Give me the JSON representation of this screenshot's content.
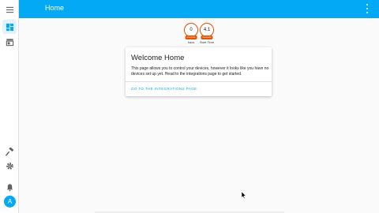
{
  "header": {
    "title": "Home"
  },
  "sidebar": {
    "avatar_initial": "A",
    "items": [
      {
        "name": "menu",
        "icon": "hamburger-icon"
      },
      {
        "name": "overview",
        "icon": "dashboard-icon",
        "active": true
      },
      {
        "name": "map",
        "icon": "store-icon"
      },
      {
        "name": "developer-tools",
        "icon": "hammer-icon"
      },
      {
        "name": "configuration",
        "icon": "gear-icon"
      },
      {
        "name": "notifications",
        "icon": "bell-icon"
      }
    ]
  },
  "badges": [
    {
      "value": "0",
      "tag": "ms (ms)",
      "label": "hacs"
    },
    {
      "value": "4.1",
      "tag": "seconds",
      "label": "Start Time"
    }
  ],
  "card": {
    "title": "Welcome Home",
    "body": "This page allows you to control your devices, however it looks like you have no devices set up yet. Head to the integrations page to get started.",
    "action": "GO TO THE INTEGRATIONS PAGE"
  },
  "colors": {
    "accent": "#03a9f4",
    "badge": "#e65100",
    "background": "#fafafa"
  }
}
